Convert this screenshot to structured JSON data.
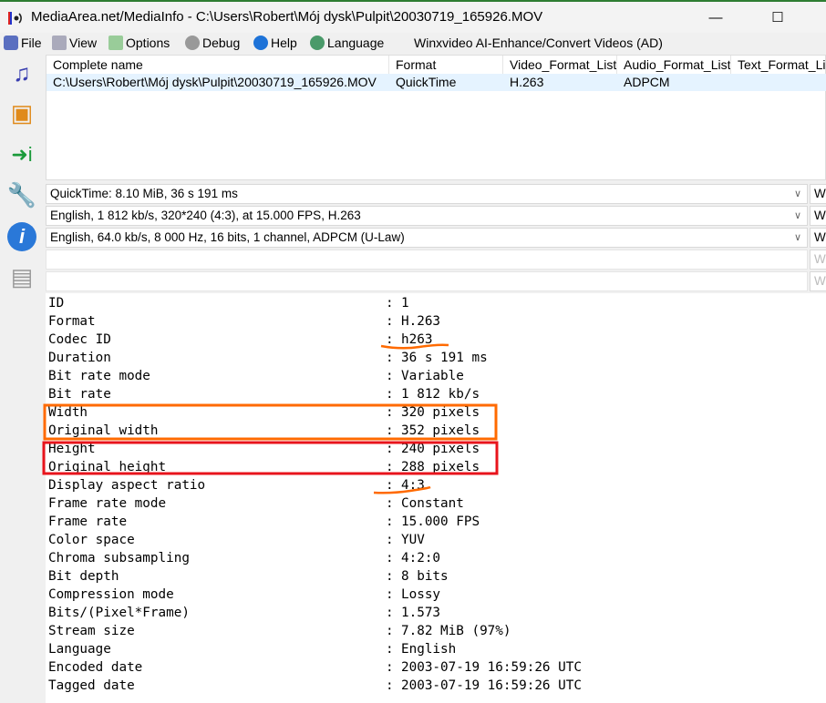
{
  "window": {
    "title": "MediaArea.net/MediaInfo - C:\\Users\\Robert\\Mój dysk\\Pulpit\\20030719_165926.MOV",
    "minimize": "—",
    "maximize": "☐",
    "close": "✕"
  },
  "menu": [
    {
      "label": "File",
      "icon": "file-icon"
    },
    {
      "label": "View",
      "icon": "view-icon"
    },
    {
      "label": "Options",
      "icon": "options-icon"
    },
    {
      "label": "Debug",
      "icon": "debug-icon"
    },
    {
      "label": "Help",
      "icon": "help-icon"
    },
    {
      "label": "Language",
      "icon": "language-icon"
    },
    {
      "label": "Winxvideo AI-Enhance/Convert Videos (AD)"
    }
  ],
  "list": {
    "columns": [
      "Complete name",
      "Format",
      "Video_Format_List",
      "Audio_Format_List",
      "Text_Format_List"
    ],
    "rows": [
      [
        "C:\\Users\\Robert\\Mój dysk\\Pulpit\\20030719_165926.MOV",
        "QuickTime",
        "H.263",
        "ADPCM",
        ""
      ]
    ]
  },
  "streams": [
    "QuickTime: 8.10 MiB, 36 s 191 ms",
    "English, 1 812 kb/s, 320*240 (4:3), at 15.000 FPS, H.263",
    "English, 64.0 kb/s, 8 000 Hz, 16 bits, 1 channel, ADPCM (U-Law)",
    "",
    ""
  ],
  "stream_button": "W",
  "details": [
    [
      "ID",
      "1"
    ],
    [
      "Format",
      "H.263"
    ],
    [
      "Codec ID",
      "h263"
    ],
    [
      "Duration",
      "36 s 191 ms"
    ],
    [
      "Bit rate mode",
      "Variable"
    ],
    [
      "Bit rate",
      "1 812 kb/s"
    ],
    [
      "Width",
      "320 pixels"
    ],
    [
      "Original width",
      "352 pixels"
    ],
    [
      "Height",
      "240 pixels"
    ],
    [
      "Original height",
      "288 pixels"
    ],
    [
      "Display aspect ratio",
      "4:3"
    ],
    [
      "Frame rate mode",
      "Constant"
    ],
    [
      "Frame rate",
      "15.000 FPS"
    ],
    [
      "Color space",
      "YUV"
    ],
    [
      "Chroma subsampling",
      "4:2:0"
    ],
    [
      "Bit depth",
      "8 bits"
    ],
    [
      "Compression mode",
      "Lossy"
    ],
    [
      "Bits/(Pixel*Frame)",
      "1.573"
    ],
    [
      "Stream size",
      "7.82 MiB (97%)"
    ],
    [
      "Language",
      "English"
    ],
    [
      "Encoded date",
      "2003-07-19 16:59:26 UTC"
    ],
    [
      "Tagged date",
      "2003-07-19 16:59:26 UTC"
    ]
  ],
  "separator": ":",
  "colors": {
    "orange": "#ff6a00",
    "red": "#e8141c",
    "selection": "#e5f3ff"
  }
}
